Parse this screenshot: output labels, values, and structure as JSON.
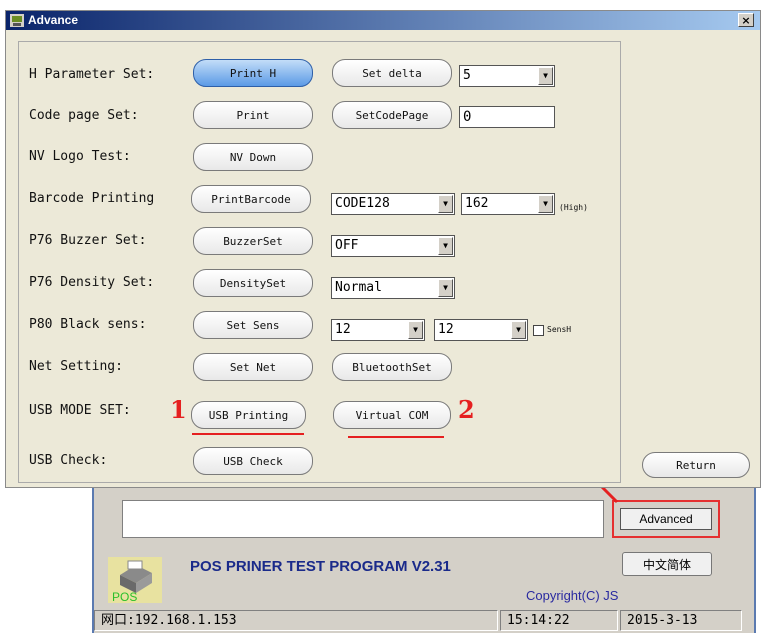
{
  "dialog": {
    "title": "Advance",
    "close": "×",
    "rows": {
      "h_param": {
        "label": "H Parameter Set:",
        "btn1": "Print H",
        "btn2": "Set delta",
        "value": "5"
      },
      "code_page": {
        "label": "Code page Set:",
        "btn1": "Print",
        "btn2": "SetCodePage",
        "value": "0"
      },
      "nv_logo": {
        "label": "NV Logo Test:",
        "btn1": "NV Down"
      },
      "barcode": {
        "label": "Barcode Printing",
        "btn1": "PrintBarcode",
        "type": "CODE128",
        "height": "162",
        "high": "(High)"
      },
      "buzzer": {
        "label": "P76 Buzzer Set:",
        "btn1": "BuzzerSet",
        "value": "OFF"
      },
      "density": {
        "label": "P76 Density Set:",
        "btn1": "DensitySet",
        "value": "Normal"
      },
      "black_sens": {
        "label": "P80 Black sens:",
        "btn1": "Set Sens",
        "value1": "12",
        "value2": "12",
        "check_label": "SensH"
      },
      "net": {
        "label": "Net Setting:",
        "btn1": "Set Net",
        "btn2": "BluetoothSet"
      },
      "usb_mode": {
        "label": "USB MODE SET:",
        "btn1": "USB Printing",
        "btn2": "Virtual COM",
        "num1": "1",
        "num2": "2"
      },
      "usb_check": {
        "label": "USB Check:",
        "btn1": "USB Check"
      }
    },
    "return_btn": "Return"
  },
  "main": {
    "advanced_btn": "Advanced",
    "program_title": "POS PRINER TEST PROGRAM V2.31",
    "lang_btn": "中文简体",
    "logo_text": "POS",
    "copyright": "Copyright(C) JS",
    "status": {
      "ip": "网口:192.168.1.153",
      "time": "15:14:22",
      "date": "2015-3-13"
    }
  },
  "colors": {
    "highlight": "#e52020",
    "title_bar": "#0a246a",
    "primary_button": "#5b9ae6"
  }
}
